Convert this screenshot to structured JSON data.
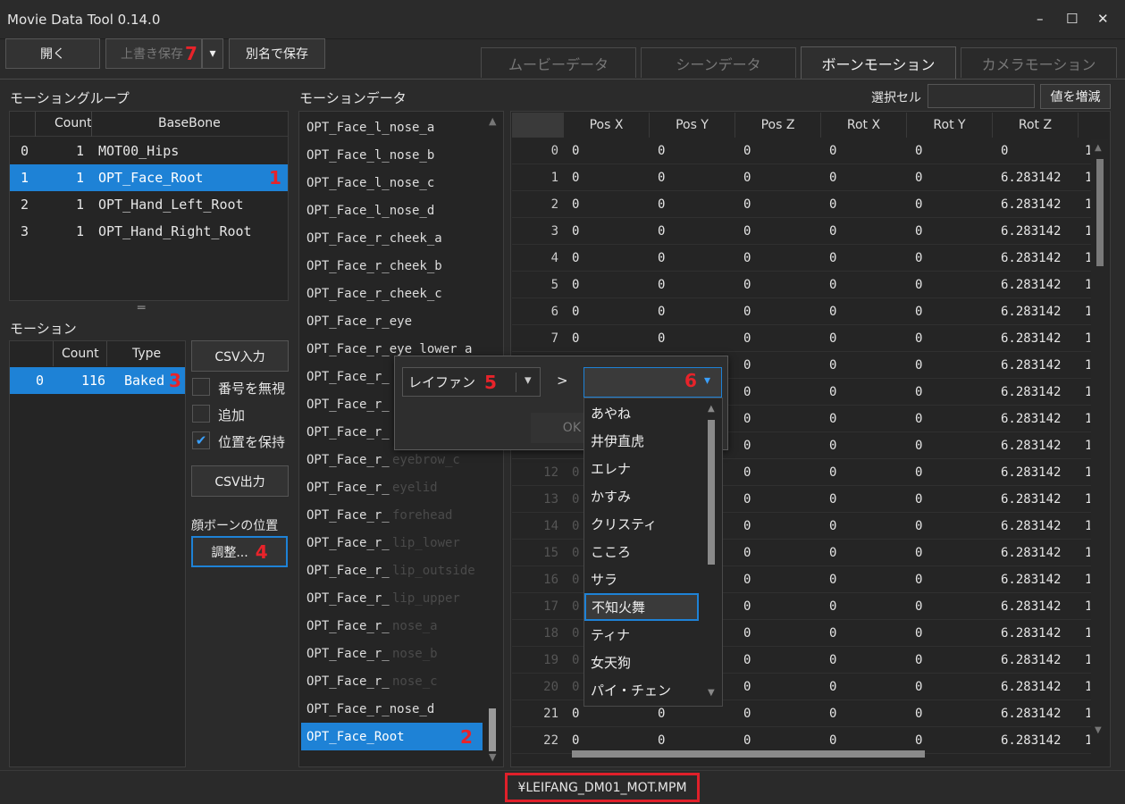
{
  "window": {
    "title": "Movie Data Tool 0.14.0",
    "minimize": "–",
    "maximize": "☐",
    "close": "✕"
  },
  "toolbar": {
    "open": "開く",
    "overwrite": "上書き保存",
    "overwrite_badge": "7",
    "dropdown": "▾",
    "save_as": "別名で保存"
  },
  "tabs": [
    "ムービーデータ",
    "シーンデータ",
    "ボーンモーション",
    "カメラモーション"
  ],
  "groups": {
    "title": "モーショングループ",
    "col_count": "Count",
    "col_base": "BaseBone",
    "rows": [
      {
        "i": "0",
        "c": "1",
        "b": "MOT00_Hips"
      },
      {
        "i": "1",
        "c": "1",
        "b": "OPT_Face_Root",
        "badge": "1"
      },
      {
        "i": "2",
        "c": "1",
        "b": "OPT_Hand_Left_Root"
      },
      {
        "i": "3",
        "c": "1",
        "b": "OPT_Hand_Right_Root"
      }
    ],
    "splitter": "═"
  },
  "motion": {
    "title": "モーション",
    "col_count": "Count",
    "col_type": "Type",
    "row": {
      "i": "0",
      "c": "116",
      "t": "Baked",
      "badge": "3"
    }
  },
  "actions": {
    "csv_in": "CSV入力",
    "ignore_num": "番号を無視",
    "add": "追加",
    "keep_pos": "位置を保持",
    "csv_out": "CSV出力",
    "face_label": "顔ボーンの位置",
    "adjust": "調整...",
    "adjust_badge": "4",
    "check": "✔"
  },
  "motion_data": {
    "title": "モーションデータ",
    "items": [
      "OPT_Face_l_nose_a",
      "OPT_Face_l_nose_b",
      "OPT_Face_l_nose_c",
      "OPT_Face_l_nose_d",
      "OPT_Face_r_cheek_a",
      "OPT_Face_r_cheek_b",
      "OPT_Face_r_cheek_c",
      "OPT_Face_r_eye",
      "OPT_Face_r_eye_lower_a",
      "OPT_Face_r_",
      "OPT_Face_r_",
      "OPT_Face_r_",
      "OPT_Face_r_",
      "OPT_Face_r_",
      "OPT_Face_r_",
      "OPT_Face_r_",
      "OPT_Face_r_",
      "OPT_Face_r_",
      "OPT_Face_r_",
      "OPT_Face_r_",
      "OPT_Face_r_",
      "OPT_Face_r_nose_d",
      "OPT_Face_Root"
    ],
    "ghost": [
      "eyebrow_c",
      "eyelid",
      "forehead",
      "lip_lower",
      "lip_outside",
      "lip_upper",
      "nose_a",
      "nose_b",
      "nose_c"
    ],
    "selected_badge": "2",
    "up": "▲",
    "down": "▼"
  },
  "grid": {
    "select_cell_label": "選択セル",
    "select_cell_value": "",
    "inc_button": "値を増減",
    "columns": [
      "Pos X",
      "Pos Y",
      "Pos Z",
      "Rot X",
      "Rot Y",
      "Rot Z"
    ],
    "rows": [
      [
        "0",
        "0",
        "0",
        "0",
        "0",
        "0",
        "0",
        "1"
      ],
      [
        "1",
        "0",
        "0",
        "0",
        "0",
        "0",
        "6.283142",
        "1"
      ],
      [
        "2",
        "0",
        "0",
        "0",
        "0",
        "0",
        "6.283142",
        "1"
      ],
      [
        "3",
        "0",
        "0",
        "0",
        "0",
        "0",
        "6.283142",
        "1"
      ],
      [
        "4",
        "0",
        "0",
        "0",
        "0",
        "0",
        "6.283142",
        "1"
      ],
      [
        "5",
        "0",
        "0",
        "0",
        "0",
        "0",
        "6.283142",
        "1"
      ],
      [
        "6",
        "0",
        "0",
        "0",
        "0",
        "0",
        "6.283142",
        "1"
      ],
      [
        "7",
        "0",
        "0",
        "0",
        "0",
        "0",
        "6.283142",
        "1"
      ],
      [
        "",
        "",
        "",
        "0",
        "0",
        "0",
        "6.283142",
        "1"
      ],
      [
        "",
        "",
        "",
        "0",
        "0",
        "0",
        "6.283142",
        "1"
      ],
      [
        "",
        "",
        "",
        "0",
        "0",
        "0",
        "6.283142",
        "1"
      ],
      [
        "",
        "",
        "",
        "0",
        "0",
        "0",
        "6.283142",
        "1"
      ],
      [
        "12",
        "0",
        "",
        "0",
        "0",
        "0",
        "6.283142",
        "1"
      ],
      [
        "13",
        "0",
        "",
        "0",
        "0",
        "0",
        "6.283142",
        "1"
      ],
      [
        "14",
        "0",
        "",
        "0",
        "0",
        "0",
        "6.283142",
        "1"
      ],
      [
        "15",
        "0",
        "",
        "0",
        "0",
        "0",
        "6.283142",
        "1"
      ],
      [
        "16",
        "0",
        "",
        "0",
        "0",
        "0",
        "6.283142",
        "1"
      ],
      [
        "17",
        "0",
        "",
        "0",
        "0",
        "0",
        "6.283142",
        "1"
      ],
      [
        "18",
        "0",
        "",
        "0",
        "0",
        "0",
        "6.283142",
        "1"
      ],
      [
        "19",
        "0",
        "",
        "0",
        "0",
        "0",
        "6.283142",
        "1"
      ],
      [
        "20",
        "0",
        "",
        "0",
        "0",
        "0",
        "6.283142",
        "1"
      ],
      [
        "21",
        "0",
        "0",
        "0",
        "0",
        "0",
        "6.283142",
        "1"
      ],
      [
        "22",
        "0",
        "0",
        "0",
        "0",
        "0",
        "6.283142",
        "1"
      ]
    ]
  },
  "dialog": {
    "character": "レイファン",
    "char_badge": "5",
    "arrow": ">",
    "target_badge": "6",
    "ok": "OK"
  },
  "dropdown": {
    "items": [
      "あやね",
      "井伊直虎",
      "エレナ",
      "かすみ",
      "クリスティ",
      "こころ",
      "サラ",
      "不知火舞",
      "ティナ",
      "女天狗",
      "パイ・チェン"
    ],
    "selected_index": 7
  },
  "status": {
    "file": "¥LEIFANG_DM01_MOT.MPM"
  }
}
